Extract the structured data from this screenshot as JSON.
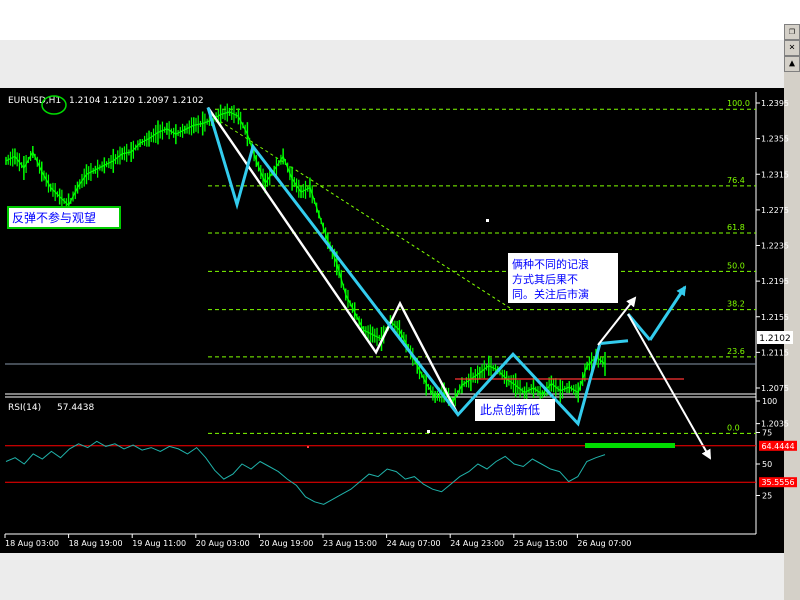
{
  "window": {
    "restore_glyph": "❐",
    "close_glyph": "×",
    "scroll_up_glyph": "▲"
  },
  "price_panel": {
    "header": {
      "symbol": "EURUSD,H1",
      "ohlc": "1.2104 1.2120 1.2097 1.2102"
    },
    "current_price": "1.2102",
    "annotations": {
      "left_box": "反弹不参与观望",
      "right_box": [
        "俩种不同的记浪",
        "方式其后果不",
        "同。关注后市演"
      ],
      "bottom_box": "此点创新低"
    }
  },
  "rsi_panel": {
    "header": {
      "label": "RSI(14)",
      "value": "57.4438"
    },
    "level_labels": [
      "64.4444",
      "35.5556"
    ]
  },
  "chart_data": [
    {
      "type": "line",
      "symbol": "EURUSD",
      "timeframe": "H1",
      "ylim": [
        2.0,
        2.0
      ],
      "y_ticks": [
        "1.2395",
        "1.2355",
        "1.2315",
        "1.2275",
        "1.2235",
        "1.2195",
        "1.2155",
        "1.2115",
        "1.2075",
        "1.2035"
      ],
      "x_ticks": [
        "18 Aug 03:00",
        "18 Aug 19:00",
        "19 Aug 11:00",
        "20 Aug 03:00",
        "20 Aug 19:00",
        "23 Aug 15:00",
        "24 Aug 07:00",
        "24 Aug 23:00",
        "25 Aug 15:00",
        "26 Aug 07:00"
      ],
      "fibonacci_levels": [
        {
          "label": "100.0",
          "price": 1.2388
        },
        {
          "label": "76.4",
          "price": 1.2302
        },
        {
          "label": "61.8",
          "price": 1.2249
        },
        {
          "label": "50.0",
          "price": 1.2206
        },
        {
          "label": "38.2",
          "price": 1.2163
        },
        {
          "label": "23.6",
          "price": 1.211
        },
        {
          "label": "0.0",
          "price": 1.2024
        }
      ],
      "current_price": 1.2102,
      "price_series": [
        1.233,
        1.2335,
        1.2322,
        1.234,
        1.2318,
        1.23,
        1.229,
        1.228,
        1.23,
        1.2315,
        1.232,
        1.2325,
        1.233,
        1.2338,
        1.234,
        1.235,
        1.2355,
        1.2362,
        1.2366,
        1.236,
        1.2365,
        1.237,
        1.2372,
        1.2376,
        1.2382,
        1.2385,
        1.238,
        1.236,
        1.233,
        1.2305,
        1.232,
        1.2335,
        1.231,
        1.2295,
        1.23,
        1.227,
        1.224,
        1.2215,
        1.218,
        1.216,
        1.214,
        1.2135,
        1.213,
        1.215,
        1.214,
        1.212,
        1.21,
        1.208,
        1.2065,
        1.207,
        1.206,
        1.2078,
        1.2085,
        1.2092,
        1.21,
        1.2095,
        1.2085,
        1.2078,
        1.207,
        1.2075,
        1.2068,
        1.208,
        1.2072,
        1.2076,
        1.207,
        1.21,
        1.211,
        1.2102
      ],
      "wave_white": [
        {
          "time": "20 Aug 03:00",
          "price": 1.239
        },
        {
          "time": "23 Aug 15:00",
          "price": 1.2115
        },
        {
          "time": "24 Aug 07:00",
          "price": 1.217
        },
        {
          "time": "24 Aug 23:00",
          "price": 1.2045
        }
      ],
      "wave_cyan": [
        {
          "time": "20 Aug 03:00",
          "price": 1.239
        },
        {
          "time": "20 Aug 19:00",
          "price": 1.2281
        },
        {
          "time": "20 Aug 19:00",
          "price": 1.2346
        },
        {
          "time": "24 Aug 23:00",
          "price": 1.2045
        },
        {
          "time": "25 Aug 15:00",
          "price": 1.2113
        },
        {
          "time": "26 Aug 07:00",
          "price": 1.2035
        },
        {
          "time": "26 Aug 07:00",
          "price": 1.2125
        }
      ]
    },
    {
      "type": "line",
      "indicator": "RSI(14)",
      "ylim": [
        0,
        100
      ],
      "y_ticks": [
        100,
        75,
        50,
        25
      ],
      "levels": [
        64.4444,
        35.5556
      ],
      "last_value": 57.4438,
      "series": [
        52,
        55,
        50,
        58,
        54,
        60,
        55,
        62,
        66,
        63,
        68,
        64,
        66,
        62,
        65,
        61,
        63,
        60,
        64,
        62,
        58,
        63,
        55,
        45,
        38,
        42,
        50,
        46,
        52,
        48,
        44,
        38,
        33,
        24,
        20,
        18,
        22,
        26,
        30,
        36,
        42,
        40,
        46,
        44,
        38,
        40,
        34,
        30,
        28,
        34,
        40,
        44,
        50,
        46,
        52,
        56,
        50,
        48,
        54,
        50,
        46,
        44,
        36,
        40,
        52,
        55,
        57.44
      ]
    }
  ],
  "colors": {
    "background": "#000000",
    "price_bars": "#00ff00",
    "wave_cyan": "#33ccee",
    "wave_white": "#ffffff",
    "fib_lines": "#80ff00",
    "rsi_levels": "#ff0000",
    "rsi_line": "#20b2aa",
    "highlight_green": "#00dd00",
    "annotation_text": "#0000ff"
  }
}
